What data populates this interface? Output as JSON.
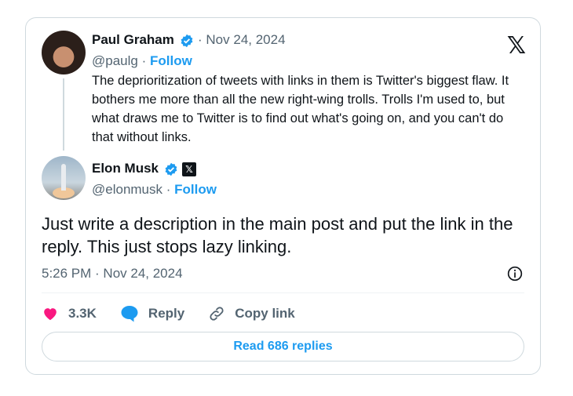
{
  "quoted_post": {
    "author_name": "Paul Graham",
    "handle": "@paulg",
    "separator": "·",
    "date": "Nov 24, 2024",
    "follow_label": "Follow",
    "text": "The deprioritization of tweets with links in them is Twitter's biggest flaw. It bothers me more than all the new right-wing trolls. Trolls I'm used to, but what draws me to Twitter is to find out what's going on, and you can't do that without links."
  },
  "reply_post": {
    "author_name": "Elon Musk",
    "handle": "@elonmusk",
    "separator": "·",
    "follow_label": "Follow",
    "text": "Just write a description in the main post and put the link in the reply. This just stops lazy linking.",
    "timestamp": "5:26 PM · Nov 24, 2024"
  },
  "actions": {
    "like_count": "3.3K",
    "reply_label": "Reply",
    "copy_link_label": "Copy link"
  },
  "read_replies_label": "Read 686 replies",
  "icons": {
    "verified": "verified-badge-icon",
    "x_logo": "x-logo-icon",
    "heart": "heart-icon",
    "reply": "reply-bubble-icon",
    "link": "link-icon",
    "info": "info-icon"
  },
  "colors": {
    "accent": "#1d9bf0",
    "like": "#f91880",
    "muted": "#536471",
    "text": "#0f1419"
  }
}
